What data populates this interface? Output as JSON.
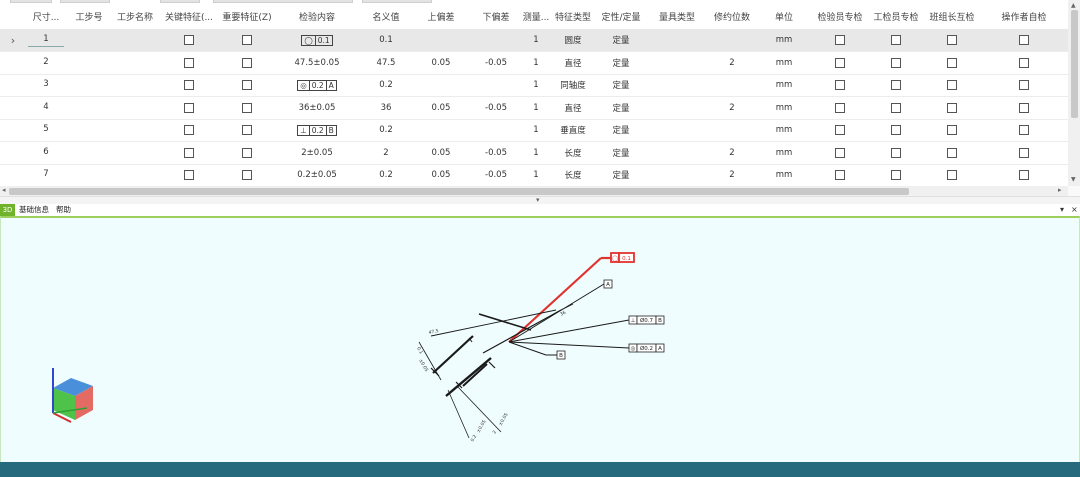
{
  "columns": [
    "",
    "尺寸...",
    "工步号",
    "工步名称",
    "关键特征(...",
    "重要特征(Z)",
    "检验内容",
    "名义值",
    "上偏差",
    "下偏差",
    "测量...",
    "特征类型",
    "定性/定量",
    "量具类型",
    "修约位数",
    "单位",
    "检验员专检",
    "工检员专检",
    "班组长互检",
    "操作者自检"
  ],
  "rows": [
    {
      "no": "1",
      "content": {
        "type": "fcf",
        "parts": [
          "◯",
          "0.1"
        ]
      },
      "nominal": "0.1",
      "upper": "",
      "lower": "",
      "measure": "1",
      "feature": "圆度",
      "qual": "定量",
      "gauge": "",
      "round": "",
      "unit": "mm",
      "selected": true
    },
    {
      "no": "2",
      "content": {
        "type": "text",
        "text": "47.5±0.05"
      },
      "nominal": "47.5",
      "upper": "0.05",
      "lower": "-0.05",
      "measure": "1",
      "feature": "直径",
      "qual": "定量",
      "gauge": "",
      "round": "2",
      "unit": "mm",
      "selected": false
    },
    {
      "no": "3",
      "content": {
        "type": "fcf",
        "parts": [
          "◎",
          "0.2",
          "A"
        ]
      },
      "nominal": "0.2",
      "upper": "",
      "lower": "",
      "measure": "1",
      "feature": "同轴度",
      "qual": "定量",
      "gauge": "",
      "round": "",
      "unit": "mm",
      "selected": false
    },
    {
      "no": "4",
      "content": {
        "type": "text",
        "text": "36±0.05"
      },
      "nominal": "36",
      "upper": "0.05",
      "lower": "-0.05",
      "measure": "1",
      "feature": "直径",
      "qual": "定量",
      "gauge": "",
      "round": "2",
      "unit": "mm",
      "selected": false
    },
    {
      "no": "5",
      "content": {
        "type": "fcf",
        "parts": [
          "⊥",
          "0.2",
          "B"
        ]
      },
      "nominal": "0.2",
      "upper": "",
      "lower": "",
      "measure": "1",
      "feature": "垂直度",
      "qual": "定量",
      "gauge": "",
      "round": "",
      "unit": "mm",
      "selected": false
    },
    {
      "no": "6",
      "content": {
        "type": "text",
        "text": "2±0.05"
      },
      "nominal": "2",
      "upper": "0.05",
      "lower": "-0.05",
      "measure": "1",
      "feature": "长度",
      "qual": "定量",
      "gauge": "",
      "round": "2",
      "unit": "mm",
      "selected": false
    },
    {
      "no": "7",
      "content": {
        "type": "text",
        "text": "0.2±0.05"
      },
      "nominal": "0.2",
      "upper": "0.05",
      "lower": "-0.05",
      "measure": "1",
      "feature": "长度",
      "qual": "定量",
      "gauge": "",
      "round": "2",
      "unit": "mm",
      "selected": false
    }
  ],
  "row_indicator": "›",
  "panel": {
    "badge": "3D",
    "menus": [
      "基础信息",
      "帮助"
    ],
    "pin_glyph": "▾",
    "close_glyph": "×"
  },
  "viewer": {
    "selected_frame": [
      "◯",
      "0.1"
    ],
    "frames": [
      {
        "parts": [
          "A"
        ]
      },
      {
        "parts": [
          "⊥",
          "Ø0.7",
          "B"
        ]
      },
      {
        "parts": [
          "◎",
          "Ø0.2",
          "A"
        ]
      },
      {
        "parts": [
          "B"
        ]
      }
    ],
    "dimension_texts": [
      "0.1",
      "±0.05",
      "2",
      "±0.05",
      "0.2",
      "±0.05",
      "47.5",
      "36"
    ]
  },
  "colors": {
    "accent_green": "#6fb32b",
    "viewer_bg": "#f0fdfe",
    "highlight_red": "#e0332f",
    "statusbar": "#266b7d"
  },
  "scrollbar_glyphs": {
    "up": "▲",
    "down": "▼",
    "left": "◂",
    "right": "▸",
    "grip": "▾"
  }
}
